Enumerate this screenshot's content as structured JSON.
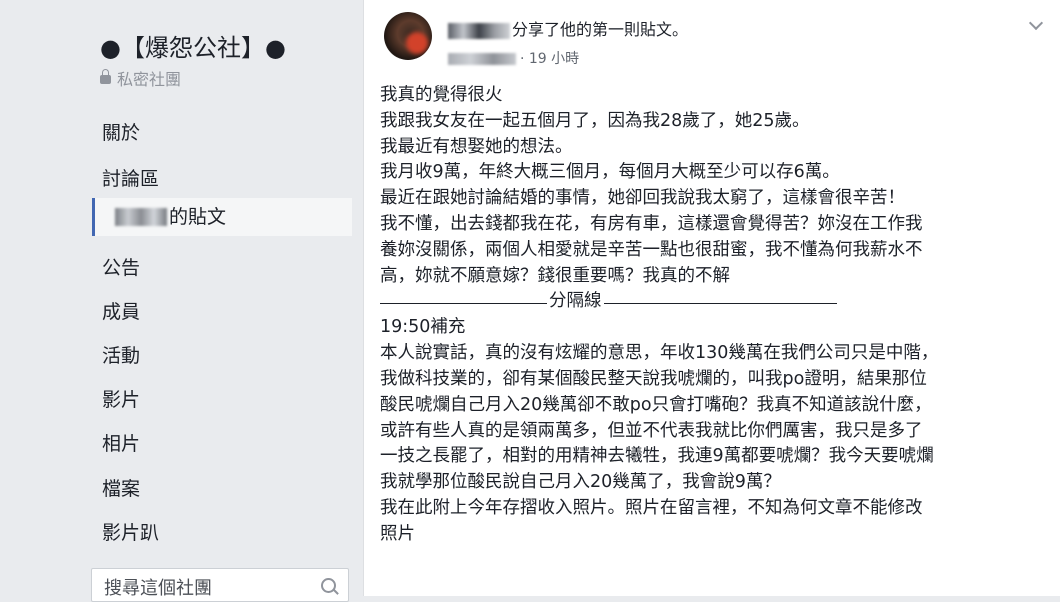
{
  "sidebar": {
    "group_name": "●【爆怨公社】●",
    "privacy_label": "私密社團",
    "nav": [
      {
        "label": "關於"
      },
      {
        "label": "討論區"
      },
      {
        "label": "的貼文"
      },
      {
        "label": "公告"
      },
      {
        "label": "成員"
      },
      {
        "label": "活動"
      },
      {
        "label": "影片"
      },
      {
        "label": "相片"
      },
      {
        "label": "檔案"
      },
      {
        "label": "影片趴"
      }
    ],
    "search_placeholder": "搜尋這個社團"
  },
  "post": {
    "author_action": "分享了他的第一則貼文。",
    "time": "· 19 小時",
    "lines": [
      "我真的覺得很火",
      "我跟我女友在一起五個月了，因為我28歲了，她25歲。",
      "我最近有想娶她的想法。",
      "我月收9萬，年終大概三個月，每個月大概至少可以存6萬。",
      "最近在跟她討論結婚的事情，她卻回我說我太窮了，這樣會很辛苦！",
      "我不懂，出去錢都我在花，有房有車，這樣還會覺得苦？妳沒在工作我",
      "養妳沒關係，兩個人相愛就是辛苦一點也很甜蜜，我不懂為何我薪水不",
      "高，妳就不願意嫁？錢很重要嗎？我真的不解"
    ],
    "divider_label": "分隔線",
    "lines2": [
      "19:50補充",
      "本人說實話，真的沒有炫耀的意思，年收130幾萬在我們公司只是中階，",
      "我做科技業的，卻有某個酸民整天說我唬爛的，叫我po證明，結果那位",
      "酸民唬爛自己月入20幾萬卻不敢po只會打嘴砲？我真不知道該說什麼，",
      "或許有些人真的是領兩萬多，但並不代表我就比你們厲害，我只是多了",
      "一技之長罷了，相對的用精神去犧牲，我連9萬都要唬爛？我今天要唬爛",
      "我就學那位酸民說自己月入20幾萬了，我會說9萬？",
      "我在此附上今年存摺收入照片。照片在留言裡，不知為何文章不能修改",
      "照片"
    ]
  }
}
